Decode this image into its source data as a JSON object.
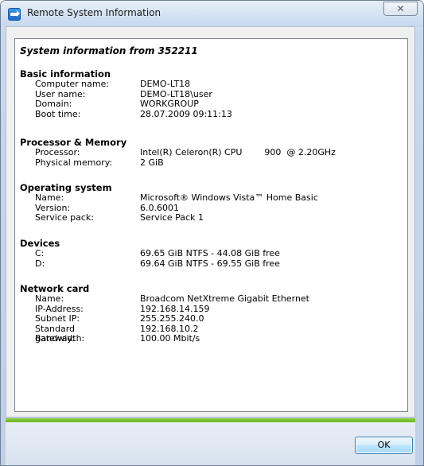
{
  "window": {
    "title": "Remote System Information",
    "close_glyph": "✕",
    "ok_label": "OK"
  },
  "heading": "System information from 352211",
  "sections": [
    {
      "title": "Basic information",
      "rows": [
        {
          "label": "Computer name:",
          "value": "DEMO-LT18"
        },
        {
          "label": "User name:",
          "value": "DEMO-LT18\\user"
        },
        {
          "label": "Domain:",
          "value": "WORKGROUP"
        },
        {
          "label": "Boot time:",
          "value": "28.07.2009 09:11:13"
        }
      ]
    },
    {
      "title": "Processor & Memory",
      "rows": [
        {
          "label": "Processor:",
          "value": "Intel(R) Celeron(R) CPU        900  @ 2.20GHz"
        },
        {
          "label": "Physical memory:",
          "value": "2 GiB"
        }
      ]
    },
    {
      "title": "Operating system",
      "rows": [
        {
          "label": "Name:",
          "value": "Microsoft® Windows Vista™ Home Basic"
        },
        {
          "label": "Version:",
          "value": "6.0.6001"
        },
        {
          "label": "Service pack:",
          "value": "Service Pack 1"
        }
      ]
    },
    {
      "title": "Devices",
      "rows": [
        {
          "label": "C:",
          "value": "69.65 GiB NTFS - 44.08 GiB free"
        },
        {
          "label": "D:",
          "value": "69.64 GiB NTFS - 69.55 GiB free"
        }
      ]
    },
    {
      "title": "Network card",
      "rows": [
        {
          "label": "Name:",
          "value": "Broadcom NetXtreme Gigabit Ethernet"
        },
        {
          "label": "IP-Address:",
          "value": "192.168.14.159"
        },
        {
          "label": "Subnet IP:",
          "value": "255.255.240.0"
        },
        {
          "label": "Standard gateway:",
          "value": "192.168.10.2"
        },
        {
          "label": "Bandwidth:",
          "value": "100.00 Mbit/s"
        }
      ]
    }
  ]
}
